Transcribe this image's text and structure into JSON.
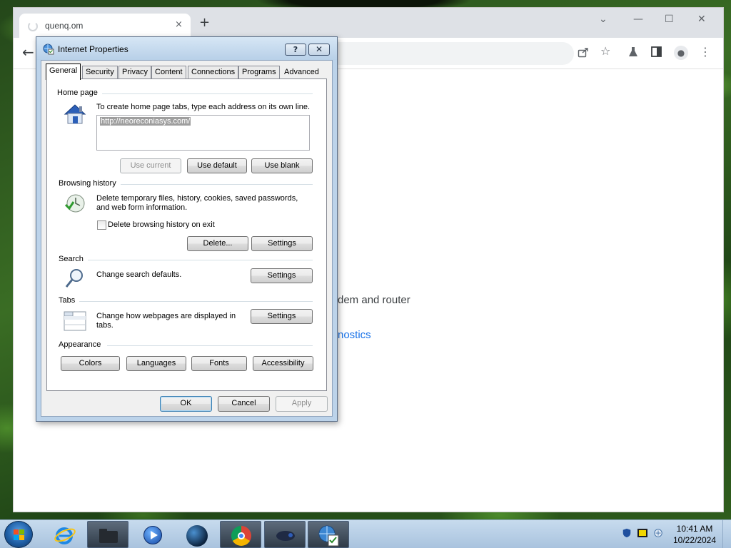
{
  "browser": {
    "tab_title": "quenq.om",
    "tab_close": "×",
    "new_tab": "+",
    "window_controls": [
      "⌄",
      "—",
      "☐",
      "✕"
    ],
    "back": "←",
    "toolbar_icons": [
      "share-icon",
      "star-icon",
      "labs-icon",
      "side-panel-icon",
      "profile-icon",
      "menu-icon"
    ],
    "page_text": "dem and router",
    "page_link": "nostics",
    "link_color": "#1a73e8"
  },
  "dialog": {
    "title": "Internet Properties",
    "help": "?",
    "close": "✕",
    "tabs": [
      "General",
      "Security",
      "Privacy",
      "Content",
      "Connections",
      "Programs",
      "Advanced"
    ],
    "active_tab": "General",
    "home_page": {
      "label": "Home page",
      "description": "To create home page tabs, type each address on its own line.",
      "url": "http://neoreconiasys.com/",
      "use_current": "Use current",
      "use_default": "Use default",
      "use_blank": "Use blank"
    },
    "browsing_history": {
      "label": "Browsing history",
      "description_line1": "Delete temporary files, history, cookies, saved passwords,",
      "description_line2": "and web form information.",
      "checkbox_label": "Delete browsing history on exit",
      "checkbox_checked": false,
      "delete": "Delete...",
      "settings": "Settings"
    },
    "search": {
      "label": "Search",
      "description": "Change search defaults.",
      "settings": "Settings"
    },
    "tabs_section": {
      "label": "Tabs",
      "description_line1": "Change how webpages are displayed in",
      "description_line2": "tabs.",
      "settings": "Settings"
    },
    "appearance": {
      "label": "Appearance",
      "colors": "Colors",
      "languages": "Languages",
      "fonts": "Fonts",
      "accessibility": "Accessibility"
    },
    "footer": {
      "ok": "OK",
      "cancel": "Cancel",
      "apply": "Apply"
    }
  },
  "taskbar": {
    "apps": [
      "internet-explorer-icon",
      "explorer-folder-icon",
      "media-player-icon",
      "globe-icon",
      "chrome-icon",
      "game-controller-icon",
      "internet-options-icon"
    ],
    "time": "10:41 AM",
    "date": "10/22/2024",
    "tray_icons": [
      "shield-icon",
      "message-icon",
      "network-icon"
    ]
  }
}
